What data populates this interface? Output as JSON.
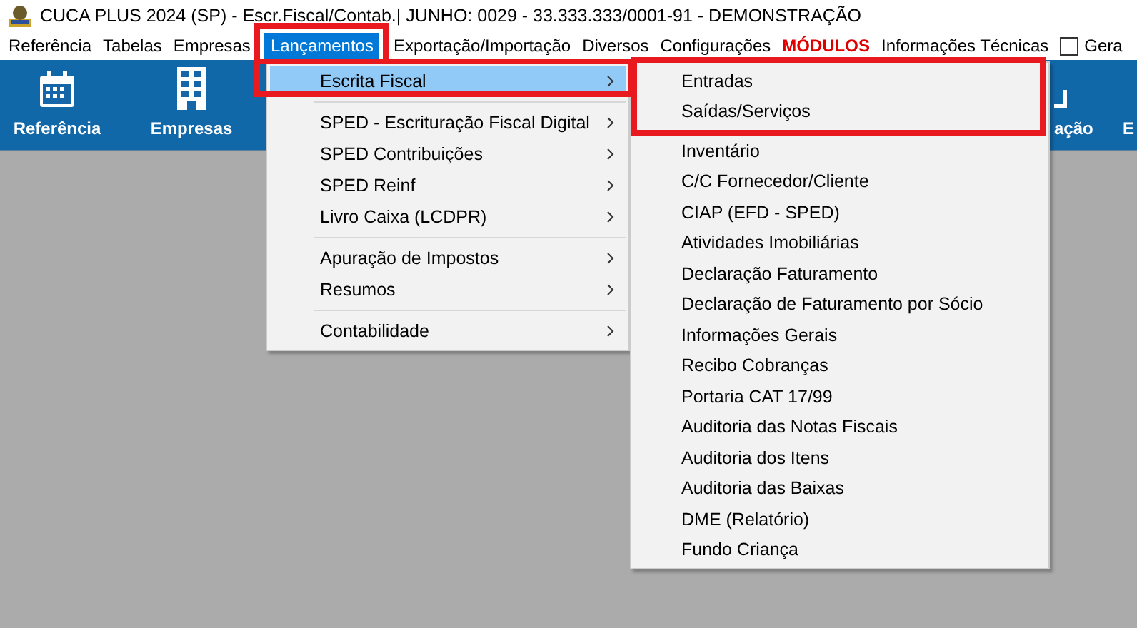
{
  "window": {
    "title": "CUCA PLUS 2024 (SP) - Escr.Fiscal/Contab.| JUNHO: 0029 - 33.333.333/0001-91 - DEMONSTRAÇÃO"
  },
  "menubar": [
    {
      "label": "Referência",
      "kind": "plain",
      "selected": false
    },
    {
      "label": "Tabelas",
      "kind": "plain",
      "selected": false
    },
    {
      "label": "Empresas",
      "kind": "plain",
      "selected": false
    },
    {
      "label": "Lançamentos",
      "kind": "plain",
      "selected": true
    },
    {
      "label": "Exportação/Importação",
      "kind": "plain",
      "selected": false
    },
    {
      "label": "Diversos",
      "kind": "plain",
      "selected": false
    },
    {
      "label": "Configurações",
      "kind": "plain",
      "selected": false
    },
    {
      "label": "MÓDULOS",
      "kind": "alert",
      "selected": false
    },
    {
      "label": "Informações Técnicas",
      "kind": "plain",
      "selected": false
    },
    {
      "label": "Gera",
      "kind": "checkbox",
      "checked": false,
      "selected": false
    }
  ],
  "toolbar": [
    {
      "label": "Referência",
      "kind": "calendar"
    },
    {
      "label": "Empresas",
      "kind": "building"
    },
    {
      "label": "ação",
      "kind": "partial"
    },
    {
      "label": "E",
      "kind": "none"
    }
  ],
  "menu": {
    "groups": [
      [
        {
          "label": "Escrita Fiscal",
          "selected": true,
          "has_submenu": true
        }
      ],
      [
        {
          "label": "SPED - Escrituração Fiscal Digital",
          "selected": false,
          "has_submenu": true
        },
        {
          "label": "SPED Contribuições",
          "selected": false,
          "has_submenu": true
        },
        {
          "label": "SPED Reinf",
          "selected": false,
          "has_submenu": true
        },
        {
          "label": "Livro Caixa (LCDPR)",
          "selected": false,
          "has_submenu": true
        }
      ],
      [
        {
          "label": "Apuração de Impostos",
          "selected": false,
          "has_submenu": true
        },
        {
          "label": "Resumos",
          "selected": false,
          "has_submenu": true
        }
      ],
      [
        {
          "label": "Contabilidade",
          "selected": false,
          "has_submenu": true
        }
      ]
    ]
  },
  "submenu": {
    "items": [
      {
        "label": "Entradas",
        "selected": false
      },
      {
        "label": "Saídas/Serviços",
        "selected": false
      },
      {
        "label": "Inventário",
        "selected": false
      },
      {
        "label": "C/C Fornecedor/Cliente",
        "selected": false
      },
      {
        "label": "CIAP (EFD - SPED)",
        "selected": false
      },
      {
        "label": "Atividades Imobiliárias",
        "selected": false
      },
      {
        "label": "Declaração Faturamento",
        "selected": false
      },
      {
        "label": "Declaração de Faturamento por Sócio",
        "selected": false
      },
      {
        "label": "Informações Gerais",
        "selected": false
      },
      {
        "label": "Recibo Cobranças",
        "selected": false
      },
      {
        "label": "Portaria CAT 17/99",
        "selected": false
      },
      {
        "label": "Auditoria das Notas Fiscais",
        "selected": false
      },
      {
        "label": "Auditoria dos Itens",
        "selected": false
      },
      {
        "label": "Auditoria das Baixas",
        "selected": false
      },
      {
        "label": "DME (Relatório)",
        "selected": false
      },
      {
        "label": "Fundo Criança",
        "selected": false
      }
    ]
  }
}
